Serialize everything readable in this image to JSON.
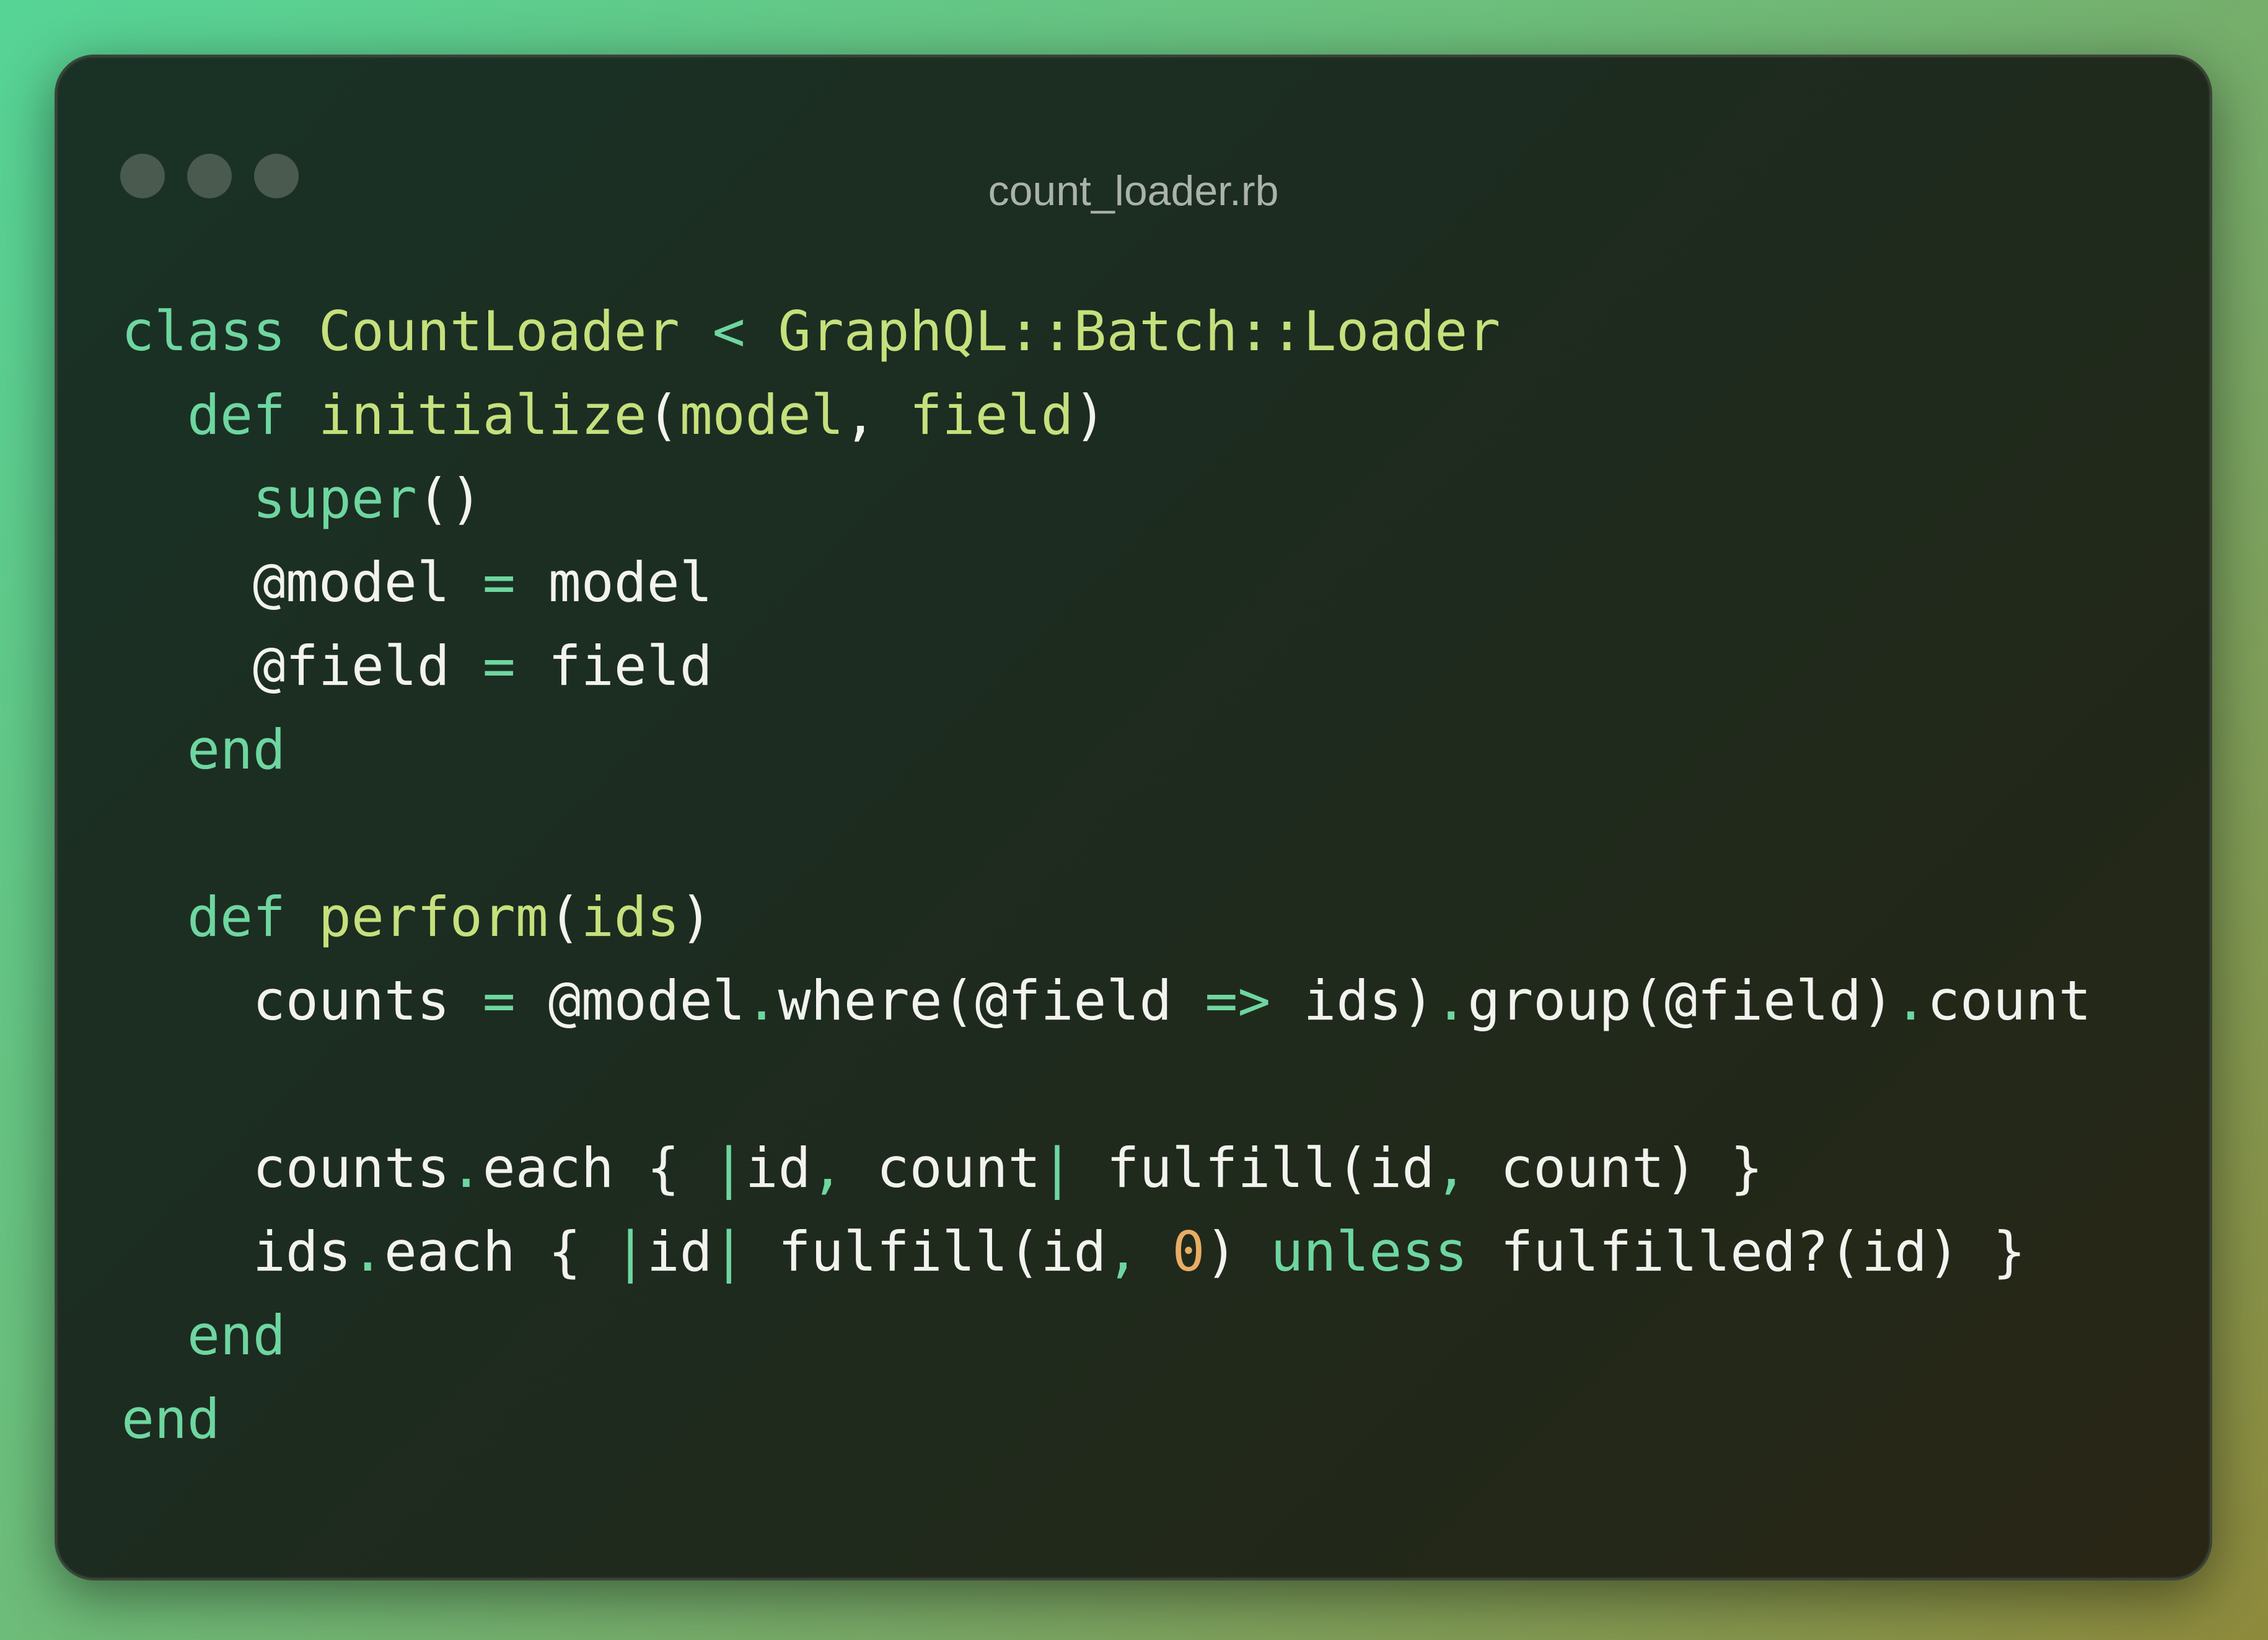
{
  "window": {
    "title": "count_loader.rb",
    "traffic_lights": [
      "close-dot",
      "minimize-dot",
      "maximize-dot"
    ]
  },
  "colors": {
    "keyword": "#6ed6a0",
    "class_and_method": "#c5e07c",
    "number": "#e8ad64",
    "plain": "#f2f2ee",
    "title": "#aab2aa"
  },
  "code": {
    "l1": {
      "a": "class",
      "b": " ",
      "c": "CountLoader",
      "d": " < ",
      "e": "GraphQL::Batch::Loader"
    },
    "l2": {
      "ind": "  ",
      "a": "def",
      "b": " ",
      "c": "initialize",
      "d": "(",
      "e": "model",
      "f": ", ",
      "g": "field",
      "h": ")"
    },
    "l3": {
      "ind": "    ",
      "a": "super",
      "b": "()"
    },
    "l4": {
      "ind": "    ",
      "a": "@model",
      "b": " = ",
      "c": "model"
    },
    "l5": {
      "ind": "    ",
      "a": "@field",
      "b": " = ",
      "c": "field"
    },
    "l6": {
      "ind": "  ",
      "a": "end"
    },
    "l7": {
      "a": ""
    },
    "l8": {
      "ind": "  ",
      "a": "def",
      "b": " ",
      "c": "perform",
      "d": "(",
      "e": "ids",
      "f": ")"
    },
    "l9": {
      "ind": "    ",
      "a": "counts",
      "b": " = ",
      "c": "@model",
      "d": ".",
      "e": "where(@field ",
      "f": "=>",
      "g": " ids)",
      "h": ".",
      "i": "group(@field)",
      "j": ".",
      "k": "count"
    },
    "l10": {
      "a": ""
    },
    "l11": {
      "ind": "    ",
      "a": "counts",
      "b": ".",
      "c": "each { ",
      "d": "|",
      "e": "id",
      "f": ", ",
      "g": "count",
      "h": "|",
      "i": " fulfill(id",
      "j": ", ",
      "k": "count) }"
    },
    "l12": {
      "ind": "    ",
      "a": "ids",
      "b": ".",
      "c": "each { ",
      "d": "|",
      "e": "id",
      "f": "|",
      "g": " fulfill(id",
      "h": ", ",
      "i": "0",
      "j": ") ",
      "k": "unless",
      "l": " fulfilled?(id) }"
    },
    "l13": {
      "ind": "  ",
      "a": "end"
    },
    "l14": {
      "a": "end"
    }
  }
}
